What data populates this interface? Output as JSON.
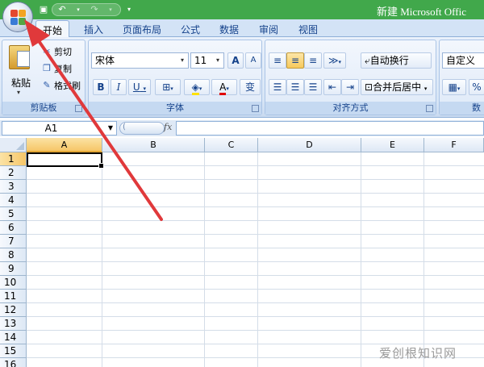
{
  "window": {
    "title": "新建 Microsoft Offic"
  },
  "tabs": [
    "开始",
    "插入",
    "页面布局",
    "公式",
    "数据",
    "审阅",
    "视图"
  ],
  "clipboard": {
    "paste": "粘贴",
    "cut": "剪切",
    "copy": "复制",
    "format_painter": "格式刷",
    "group_label": "剪贴板"
  },
  "font": {
    "name": "宋体",
    "size": "11",
    "grow": "A",
    "shrink": "A",
    "bold": "B",
    "italic": "I",
    "underline": "U",
    "color_letter": "A",
    "wen": "变",
    "group_label": "字体"
  },
  "alignment": {
    "wrap_text": "自动换行",
    "merge_center": "合并后居中",
    "group_label": "对齐方式"
  },
  "number": {
    "format": "自定义",
    "group_label": "数"
  },
  "formula_bar": {
    "name_box": "A1",
    "fx": "fx"
  },
  "columns": [
    "A",
    "B",
    "C",
    "D",
    "E",
    "F"
  ],
  "rows": [
    "1",
    "2",
    "3",
    "4",
    "5",
    "6",
    "7",
    "8",
    "9",
    "10",
    "11",
    "12",
    "13",
    "14",
    "15",
    "16"
  ],
  "watermark": "爱创根知识网",
  "colors": {
    "title_bar": "#41a84b",
    "arrow": "#e0393b",
    "selection": "#f6c667"
  }
}
